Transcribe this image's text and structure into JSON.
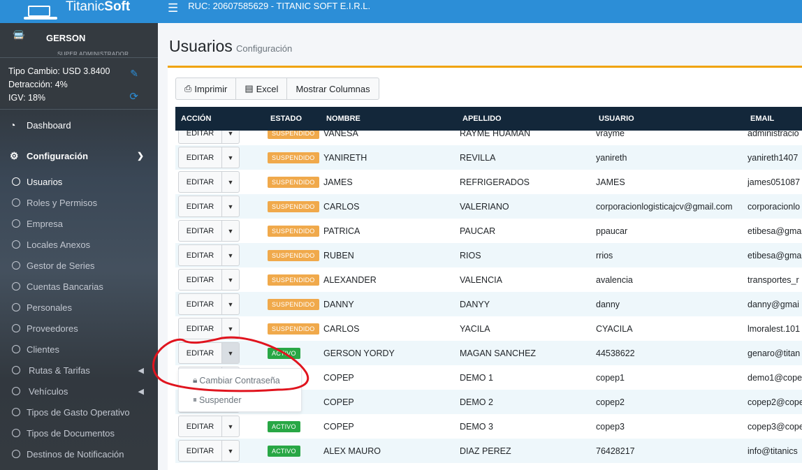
{
  "app": {
    "brand_light": "Titanic",
    "brand_bold": "Soft",
    "ruc": "RUC: 20607585629 - TITANIC SOFT E.I.R.L."
  },
  "user": {
    "name": "GERSON",
    "role": "SUPER ADMINISTRADOR"
  },
  "info": {
    "tipo_cambio": "Tipo Cambio: USD 3.8400",
    "detraccion": "Detracción: 4%",
    "igv": "IGV: 18%"
  },
  "nav": {
    "dashboard": "Dashboard",
    "configuracion": "Configuración",
    "sub_items": [
      {
        "label": "Usuarios",
        "active": true
      },
      {
        "label": "Roles y Permisos"
      },
      {
        "label": "Empresa"
      },
      {
        "label": "Locales Anexos"
      },
      {
        "label": "Gestor de Series"
      },
      {
        "label": "Cuentas Bancarias"
      },
      {
        "label": "Personales"
      },
      {
        "label": "Proveedores"
      },
      {
        "label": "Clientes"
      },
      {
        "label": "Rutas & Tarifas"
      },
      {
        "label": "Vehículos"
      },
      {
        "label": "Tipos de Gasto Operativo"
      },
      {
        "label": "Tipos de Documentos"
      },
      {
        "label": "Destinos de Notificación"
      }
    ]
  },
  "page": {
    "title": "Usuarios",
    "subtitle": "Configuración"
  },
  "toolbar": {
    "print": "Imprimir",
    "excel": "Excel",
    "columns": "Mostrar Columnas"
  },
  "table": {
    "headers": {
      "accion": "ACCIÓN",
      "estado": "ESTADO",
      "nombre": "NOMBRE",
      "apellido": "APELLIDO",
      "usuario": "USUARIO",
      "email": "EMAIL"
    },
    "edit_label": "EDITAR",
    "rows": [
      {
        "estado": "SUSPENDIDO",
        "nombre": "VANESA",
        "apellido": "RAYME HUAMAN",
        "usuario": "vrayme",
        "email": "administracio"
      },
      {
        "estado": "SUSPENDIDO",
        "nombre": "YANIRETH",
        "apellido": "REVILLA",
        "usuario": "yanireth",
        "email": "yanireth1407"
      },
      {
        "estado": "SUSPENDIDO",
        "nombre": "JAMES",
        "apellido": "REFRIGERADOS",
        "usuario": "JAMES",
        "email": "james051087"
      },
      {
        "estado": "SUSPENDIDO",
        "nombre": "CARLOS",
        "apellido": "VALERIANO",
        "usuario": "corporacionlogisticajcv@gmail.com",
        "email": "corporacionlo"
      },
      {
        "estado": "SUSPENDIDO",
        "nombre": "PATRICA",
        "apellido": "PAUCAR",
        "usuario": "ppaucar",
        "email": "etibesa@gma"
      },
      {
        "estado": "SUSPENDIDO",
        "nombre": "RUBEN",
        "apellido": "RIOS",
        "usuario": "rrios",
        "email": "etibesa@gma"
      },
      {
        "estado": "SUSPENDIDO",
        "nombre": "ALEXANDER",
        "apellido": "VALENCIA",
        "usuario": "avalencia",
        "email": "transportes_r"
      },
      {
        "estado": "SUSPENDIDO",
        "nombre": "DANNY",
        "apellido": "DANYY",
        "usuario": "danny",
        "email": "danny@gmai"
      },
      {
        "estado": "SUSPENDIDO",
        "nombre": "CARLOS",
        "apellido": "YACILA",
        "usuario": "CYACILA",
        "email": "lmoralest.101"
      },
      {
        "estado": "ACTIVO",
        "nombre": "GERSON YORDY",
        "apellido": "MAGAN SANCHEZ",
        "usuario": "44538622",
        "email": "genaro@titan"
      },
      {
        "estado": "",
        "nombre": "COPEP",
        "apellido": "DEMO 1",
        "usuario": "copep1",
        "email": "demo1@cope"
      },
      {
        "estado": "",
        "nombre": "COPEP",
        "apellido": "DEMO 2",
        "usuario": "copep2",
        "email": "copep2@cope"
      },
      {
        "estado": "ACTIVO",
        "nombre": "COPEP",
        "apellido": "DEMO 3",
        "usuario": "copep3",
        "email": "copep3@cope"
      },
      {
        "estado": "ACTIVO",
        "nombre": "ALEX MAURO",
        "apellido": "DIAZ PEREZ",
        "usuario": "76428217",
        "email": "info@titanics"
      }
    ]
  },
  "dropdown_menu": {
    "change_password": "Cambiar Contraseña",
    "suspend": "Suspender"
  },
  "colors": {
    "topbar": "#2c8ed7",
    "sidebar": "#343a40",
    "table_header": "#13273a",
    "suspended_badge": "#f0a94b",
    "active_badge": "#28a745",
    "card_accent": "#f0a30a",
    "annotation": "#e0141e"
  }
}
